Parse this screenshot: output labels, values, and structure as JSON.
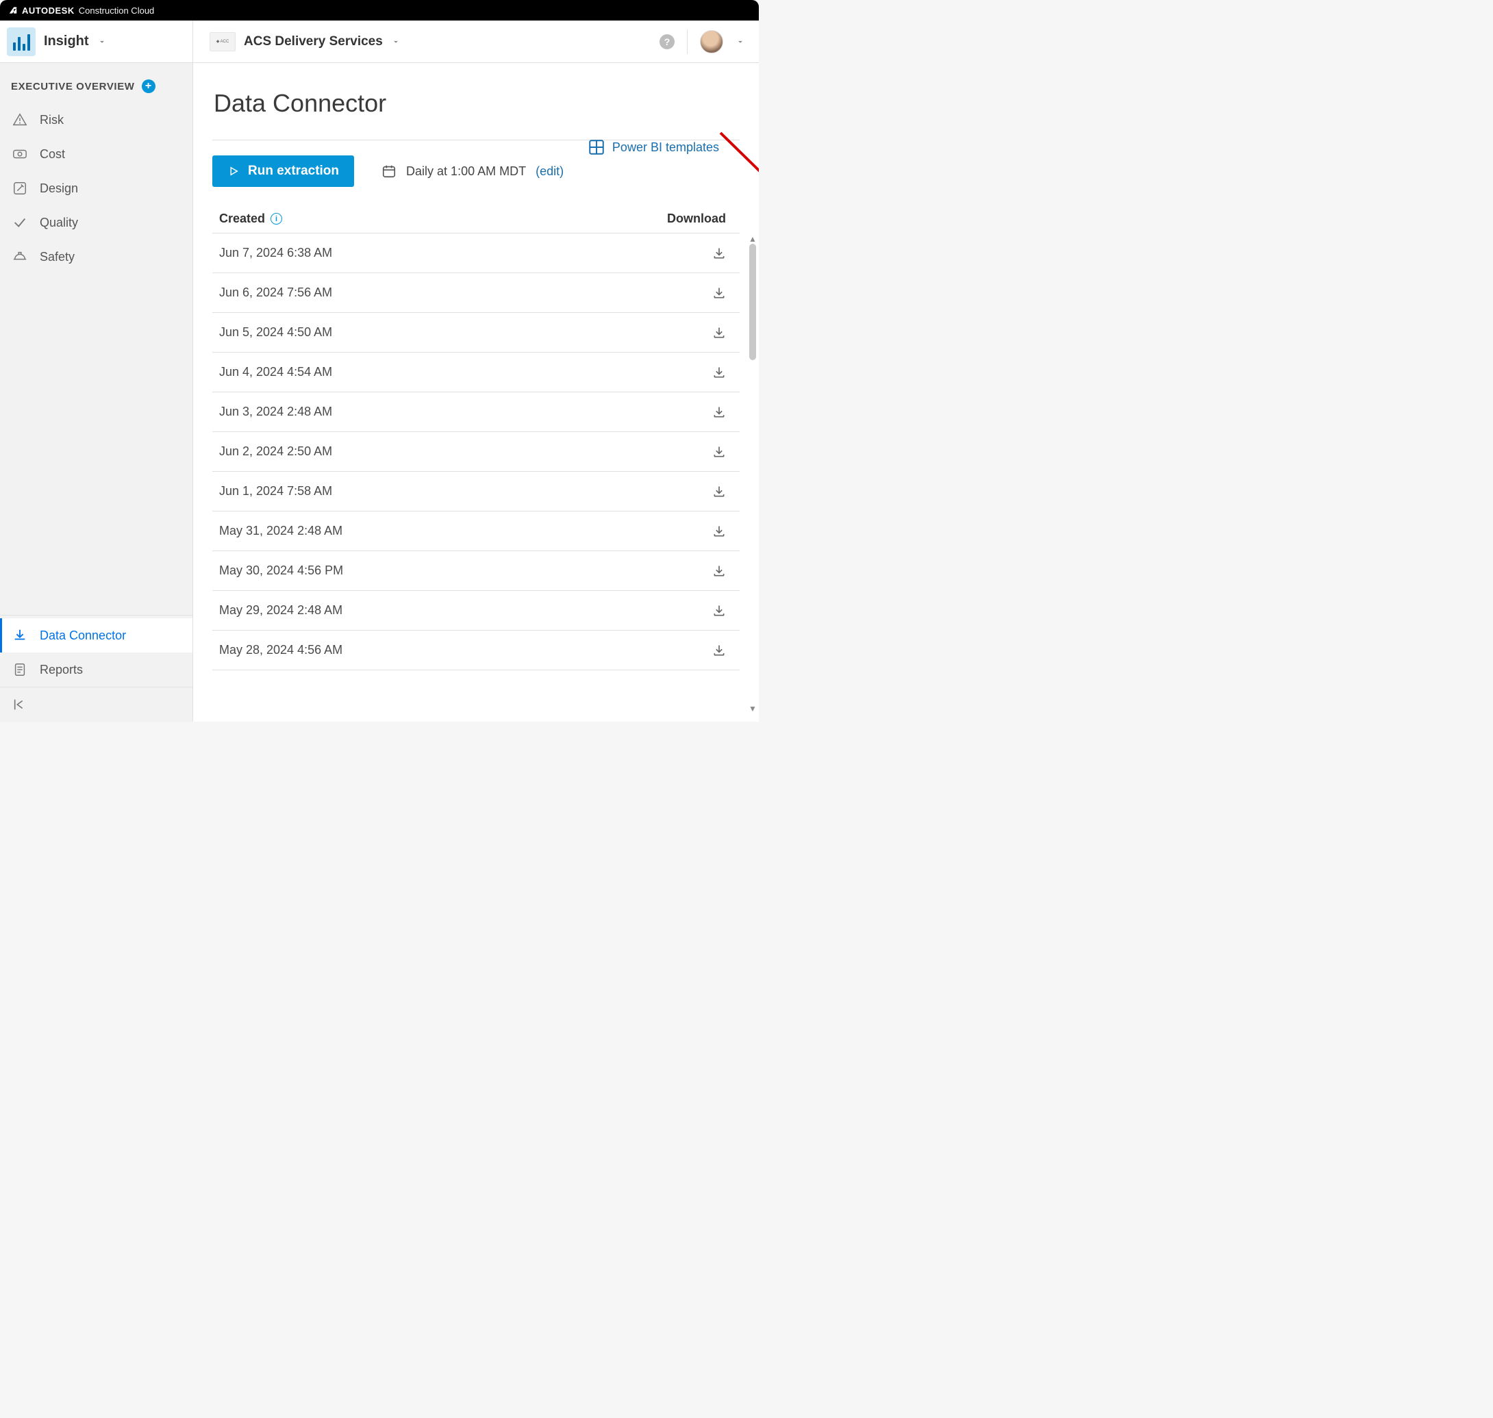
{
  "brand": {
    "company": "AUTODESK",
    "product": "Construction Cloud"
  },
  "module": {
    "name": "Insight"
  },
  "project": {
    "name": "ACS Delivery Services"
  },
  "sidebar": {
    "section_title": "EXECUTIVE OVERVIEW",
    "items": [
      {
        "label": "Risk"
      },
      {
        "label": "Cost"
      },
      {
        "label": "Design"
      },
      {
        "label": "Quality"
      },
      {
        "label": "Safety"
      }
    ],
    "bottom": [
      {
        "label": "Data Connector",
        "selected": true
      },
      {
        "label": "Reports",
        "selected": false
      }
    ]
  },
  "page": {
    "title": "Data Connector",
    "powerbi_link": "Power BI templates",
    "run_button": "Run extraction",
    "schedule_text": "Daily at 1:00 AM MDT",
    "edit_label": "(edit)",
    "columns": {
      "created": "Created",
      "download": "Download"
    }
  },
  "extractions": [
    {
      "created": "Jun 7, 2024 6:38 AM"
    },
    {
      "created": "Jun 6, 2024 7:56 AM"
    },
    {
      "created": "Jun 5, 2024 4:50 AM"
    },
    {
      "created": "Jun 4, 2024 4:54 AM"
    },
    {
      "created": "Jun 3, 2024 2:48 AM"
    },
    {
      "created": "Jun 2, 2024 2:50 AM"
    },
    {
      "created": "Jun 1, 2024 7:58 AM"
    },
    {
      "created": "May 31, 2024 2:48 AM"
    },
    {
      "created": "May 30, 2024 4:56 PM"
    },
    {
      "created": "May 29, 2024 2:48 AM"
    },
    {
      "created": "May 28, 2024 4:56 AM"
    }
  ]
}
